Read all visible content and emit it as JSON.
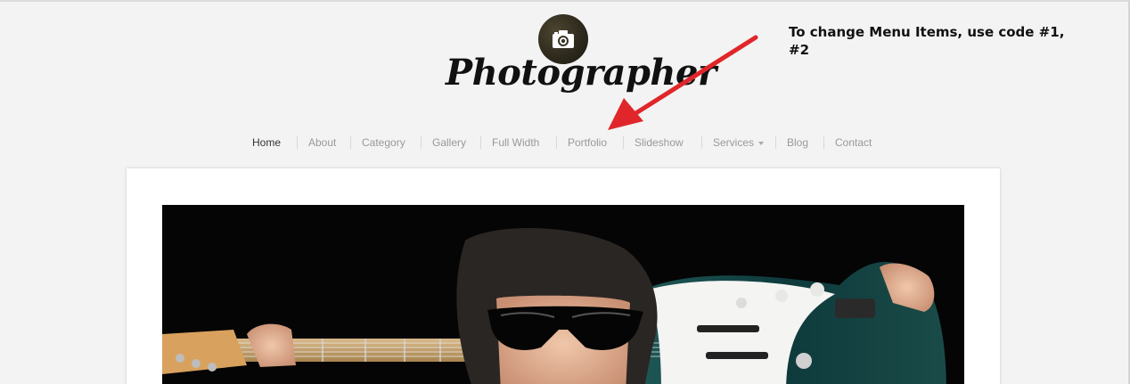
{
  "site": {
    "title": "Photographer",
    "logo_icon": "camera-icon"
  },
  "annotation": {
    "text": "To change Menu Items, use code #1, #2",
    "arrow_color": "#e0262a"
  },
  "nav": {
    "items": [
      {
        "label": "Home",
        "active": true
      },
      {
        "label": "About"
      },
      {
        "label": "Category"
      },
      {
        "label": "Gallery"
      },
      {
        "label": "Full Width"
      },
      {
        "label": "Portfolio"
      },
      {
        "label": "Slideshow"
      },
      {
        "label": "Services",
        "has_dropdown": true
      },
      {
        "label": "Blog"
      },
      {
        "label": "Contact"
      }
    ]
  },
  "main": {
    "hero_image": "musician-with-guitar-photo"
  },
  "colors": {
    "background": "#f3f3f3",
    "nav_text": "#999999",
    "nav_active": "#333333"
  }
}
